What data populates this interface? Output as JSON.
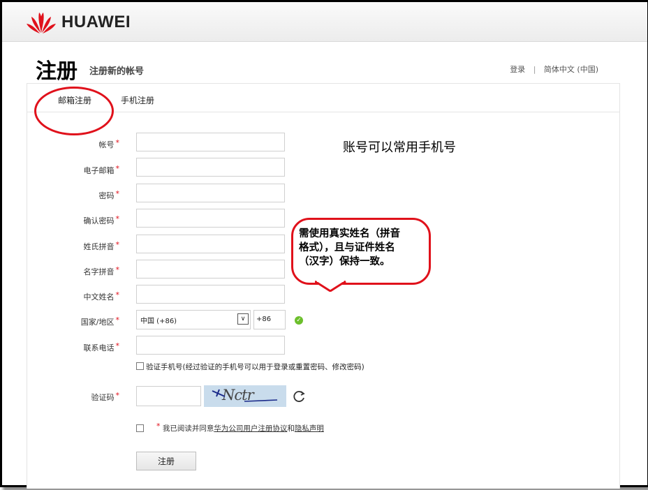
{
  "brand": {
    "name": "HUAWEI",
    "color": "#e0111b"
  },
  "page": {
    "title": "注册",
    "subtitle": "注册新的帐号"
  },
  "top_links": {
    "login": "登录",
    "separator": "|",
    "language": "简体中文 (中国)"
  },
  "tabs": [
    {
      "label": "邮箱注册",
      "active": true
    },
    {
      "label": "手机注册",
      "active": false
    }
  ],
  "form": {
    "required_mark": "*",
    "fields": [
      {
        "label": "帐号"
      },
      {
        "label": "电子邮箱"
      },
      {
        "label": "密码"
      },
      {
        "label": "确认密码"
      },
      {
        "label": "姓氏拼音"
      },
      {
        "label": "名字拼音"
      },
      {
        "label": "中文姓名"
      },
      {
        "label": "国家/地区"
      },
      {
        "label": "联系电话"
      }
    ],
    "country_select": {
      "value": "中国 (+86)",
      "code": "+86",
      "arrow_icon": "chevron-down-icon",
      "status_icon": "check-circle-icon"
    },
    "verify_phone": {
      "label": "验证手机号(经过验证的手机号可以用于登录或重置密码、修改密码)",
      "checked": false
    },
    "captcha": {
      "label": "验证码",
      "image_text": "Nctr",
      "refresh_icon": "refresh-icon"
    },
    "agreement": {
      "prefix": "我已阅读并同意",
      "link1": "华为公司用户注册协议",
      "middle": "和",
      "link2": "隐私声明",
      "checked": false
    },
    "submit_label": "注册"
  },
  "annotations": {
    "account_note": "账号可以常用手机号",
    "name_bubble_lines": [
      "需使用真实姓名（拼音",
      "格式），且与证件姓名",
      "（汉字）保持一致。"
    ]
  }
}
